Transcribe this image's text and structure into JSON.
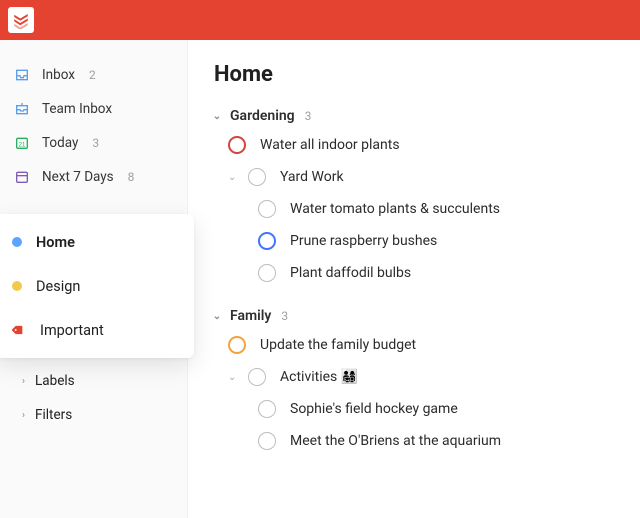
{
  "colors": {
    "brand": "#e44332",
    "home_dot": "#5ea3ff",
    "design_dot": "#f2c94c",
    "important_tag": "#e44332"
  },
  "sidebar": {
    "inbox": {
      "label": "Inbox",
      "count": "2"
    },
    "team_inbox": {
      "label": "Team Inbox"
    },
    "today": {
      "label": "Today",
      "count": "3"
    },
    "next7": {
      "label": "Next 7 Days",
      "count": "8"
    },
    "projects": {
      "home": {
        "label": "Home"
      },
      "design": {
        "label": "Design"
      },
      "important": {
        "label": "Important"
      }
    },
    "groups": {
      "labels": {
        "label": "Labels"
      },
      "filters": {
        "label": "Filters"
      }
    }
  },
  "main": {
    "title": "Home",
    "sections": {
      "gardening": {
        "label": "Gardening",
        "count": "3",
        "tasks": {
          "water_indoor": {
            "label": "Water all indoor plants"
          },
          "yard_work": {
            "label": "Yard Work",
            "children": {
              "tomato": {
                "label": "Water tomato plants & succulents"
              },
              "prune": {
                "label": "Prune raspberry bushes"
              },
              "daffodil": {
                "label": "Plant daffodil bulbs"
              }
            }
          }
        }
      },
      "family": {
        "label": "Family",
        "count": "3",
        "tasks": {
          "budget": {
            "label": "Update the family budget"
          },
          "activities": {
            "label": "Activities 👨‍👩‍👧‍👦",
            "children": {
              "sophie": {
                "label": "Sophie's field hockey game"
              },
              "obriens": {
                "label": "Meet the O'Briens at the aquarium"
              }
            }
          }
        }
      }
    }
  }
}
